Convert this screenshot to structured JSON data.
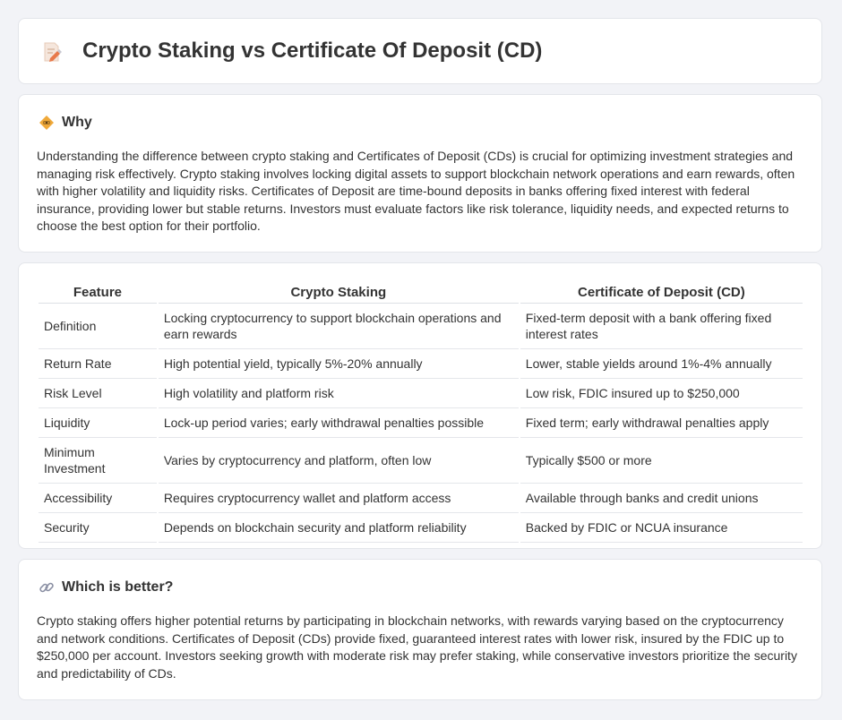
{
  "header": {
    "title": "Crypto Staking vs Certificate Of Deposit (CD)",
    "icon": "document-pencil-icon"
  },
  "why": {
    "heading": "Why",
    "icon": "warning-diamond-icon",
    "text": "Understanding the difference between crypto staking and Certificates of Deposit (CDs) is crucial for optimizing investment strategies and managing risk effectively. Crypto staking involves locking digital assets to support blockchain network operations and earn rewards, often with higher volatility and liquidity risks. Certificates of Deposit are time-bound deposits in banks offering fixed interest with federal insurance, providing lower but stable returns. Investors must evaluate factors like risk tolerance, liquidity needs, and expected returns to choose the best option for their portfolio."
  },
  "table": {
    "headers": [
      "Feature",
      "Crypto Staking",
      "Certificate of Deposit (CD)"
    ],
    "rows": [
      [
        "Definition",
        "Locking cryptocurrency to support blockchain operations and earn rewards",
        "Fixed-term deposit with a bank offering fixed interest rates"
      ],
      [
        "Return Rate",
        "High potential yield, typically 5%-20% annually",
        "Lower, stable yields around 1%-4% annually"
      ],
      [
        "Risk Level",
        "High volatility and platform risk",
        "Low risk, FDIC insured up to $250,000"
      ],
      [
        "Liquidity",
        "Lock-up period varies; early withdrawal penalties possible",
        "Fixed term; early withdrawal penalties apply"
      ],
      [
        "Minimum Investment",
        "Varies by cryptocurrency and platform, often low",
        "Typically $500 or more"
      ],
      [
        "Accessibility",
        "Requires cryptocurrency wallet and platform access",
        "Available through banks and credit unions"
      ],
      [
        "Security",
        "Depends on blockchain security and platform reliability",
        "Backed by FDIC or NCUA insurance"
      ]
    ]
  },
  "better": {
    "heading": "Which is better?",
    "icon": "link-icon",
    "text": "Crypto staking offers higher potential returns by participating in blockchain networks, with rewards varying based on the cryptocurrency and network conditions. Certificates of Deposit (CDs) provide fixed, guaranteed interest rates with lower risk, insured by the FDIC up to $250,000 per account. Investors seeking growth with moderate risk may prefer staking, while conservative investors prioritize the security and predictability of CDs."
  }
}
